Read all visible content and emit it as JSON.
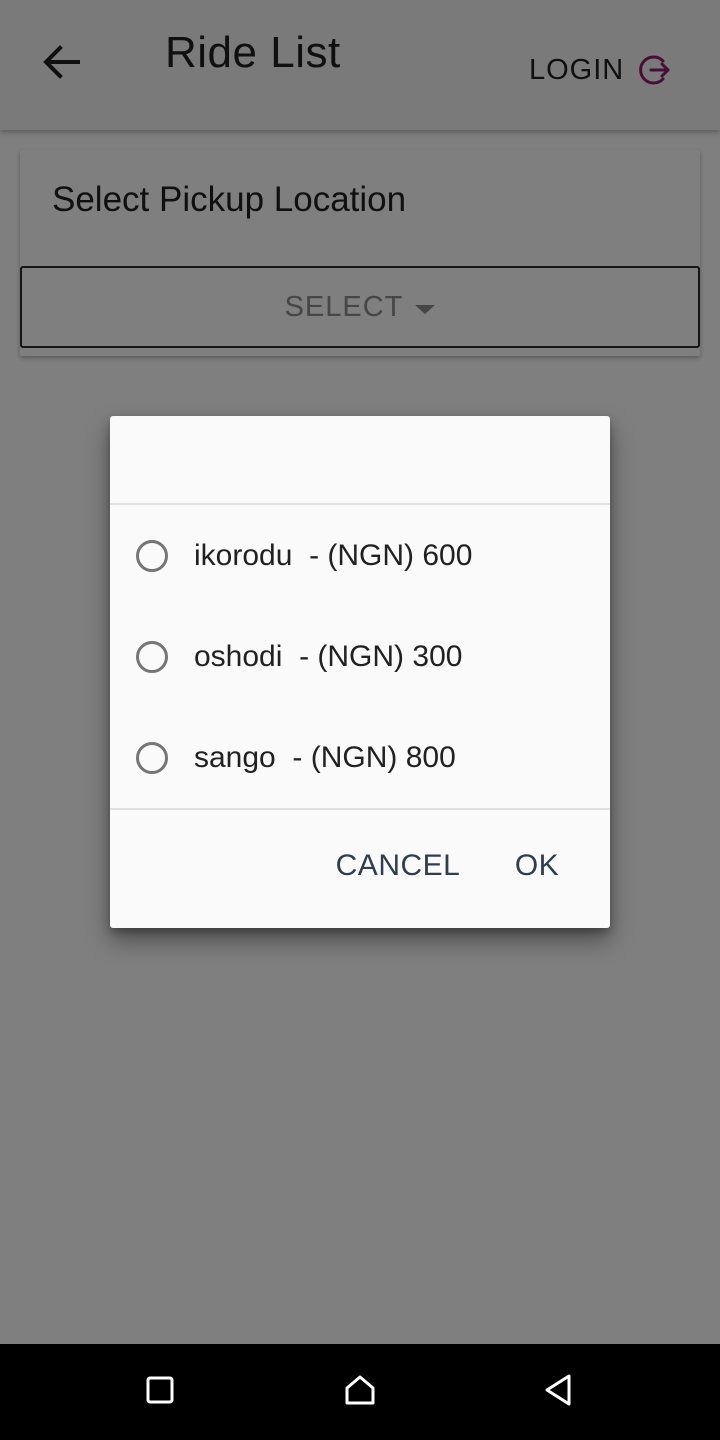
{
  "app_bar": {
    "title": "Ride List",
    "login_label": "LOGIN",
    "back_icon": "arrow-left-icon",
    "login_icon": "logout-arrow-icon",
    "login_icon_color": "#8e1e6d"
  },
  "card": {
    "title": "Select Pickup Location",
    "select_label": "SELECT"
  },
  "dialog": {
    "title": "",
    "options": [
      {
        "label": "ikorodu  - (NGN) 600",
        "selected": false
      },
      {
        "label": "oshodi  - (NGN) 300",
        "selected": false
      },
      {
        "label": "sango  - (NGN) 800",
        "selected": false
      }
    ],
    "cancel_label": "CANCEL",
    "ok_label": "OK",
    "action_color": "#2c3e50"
  },
  "nav_bar": {
    "recents_icon": "square-icon",
    "home_icon": "home-icon",
    "back_icon": "triangle-back-icon"
  }
}
